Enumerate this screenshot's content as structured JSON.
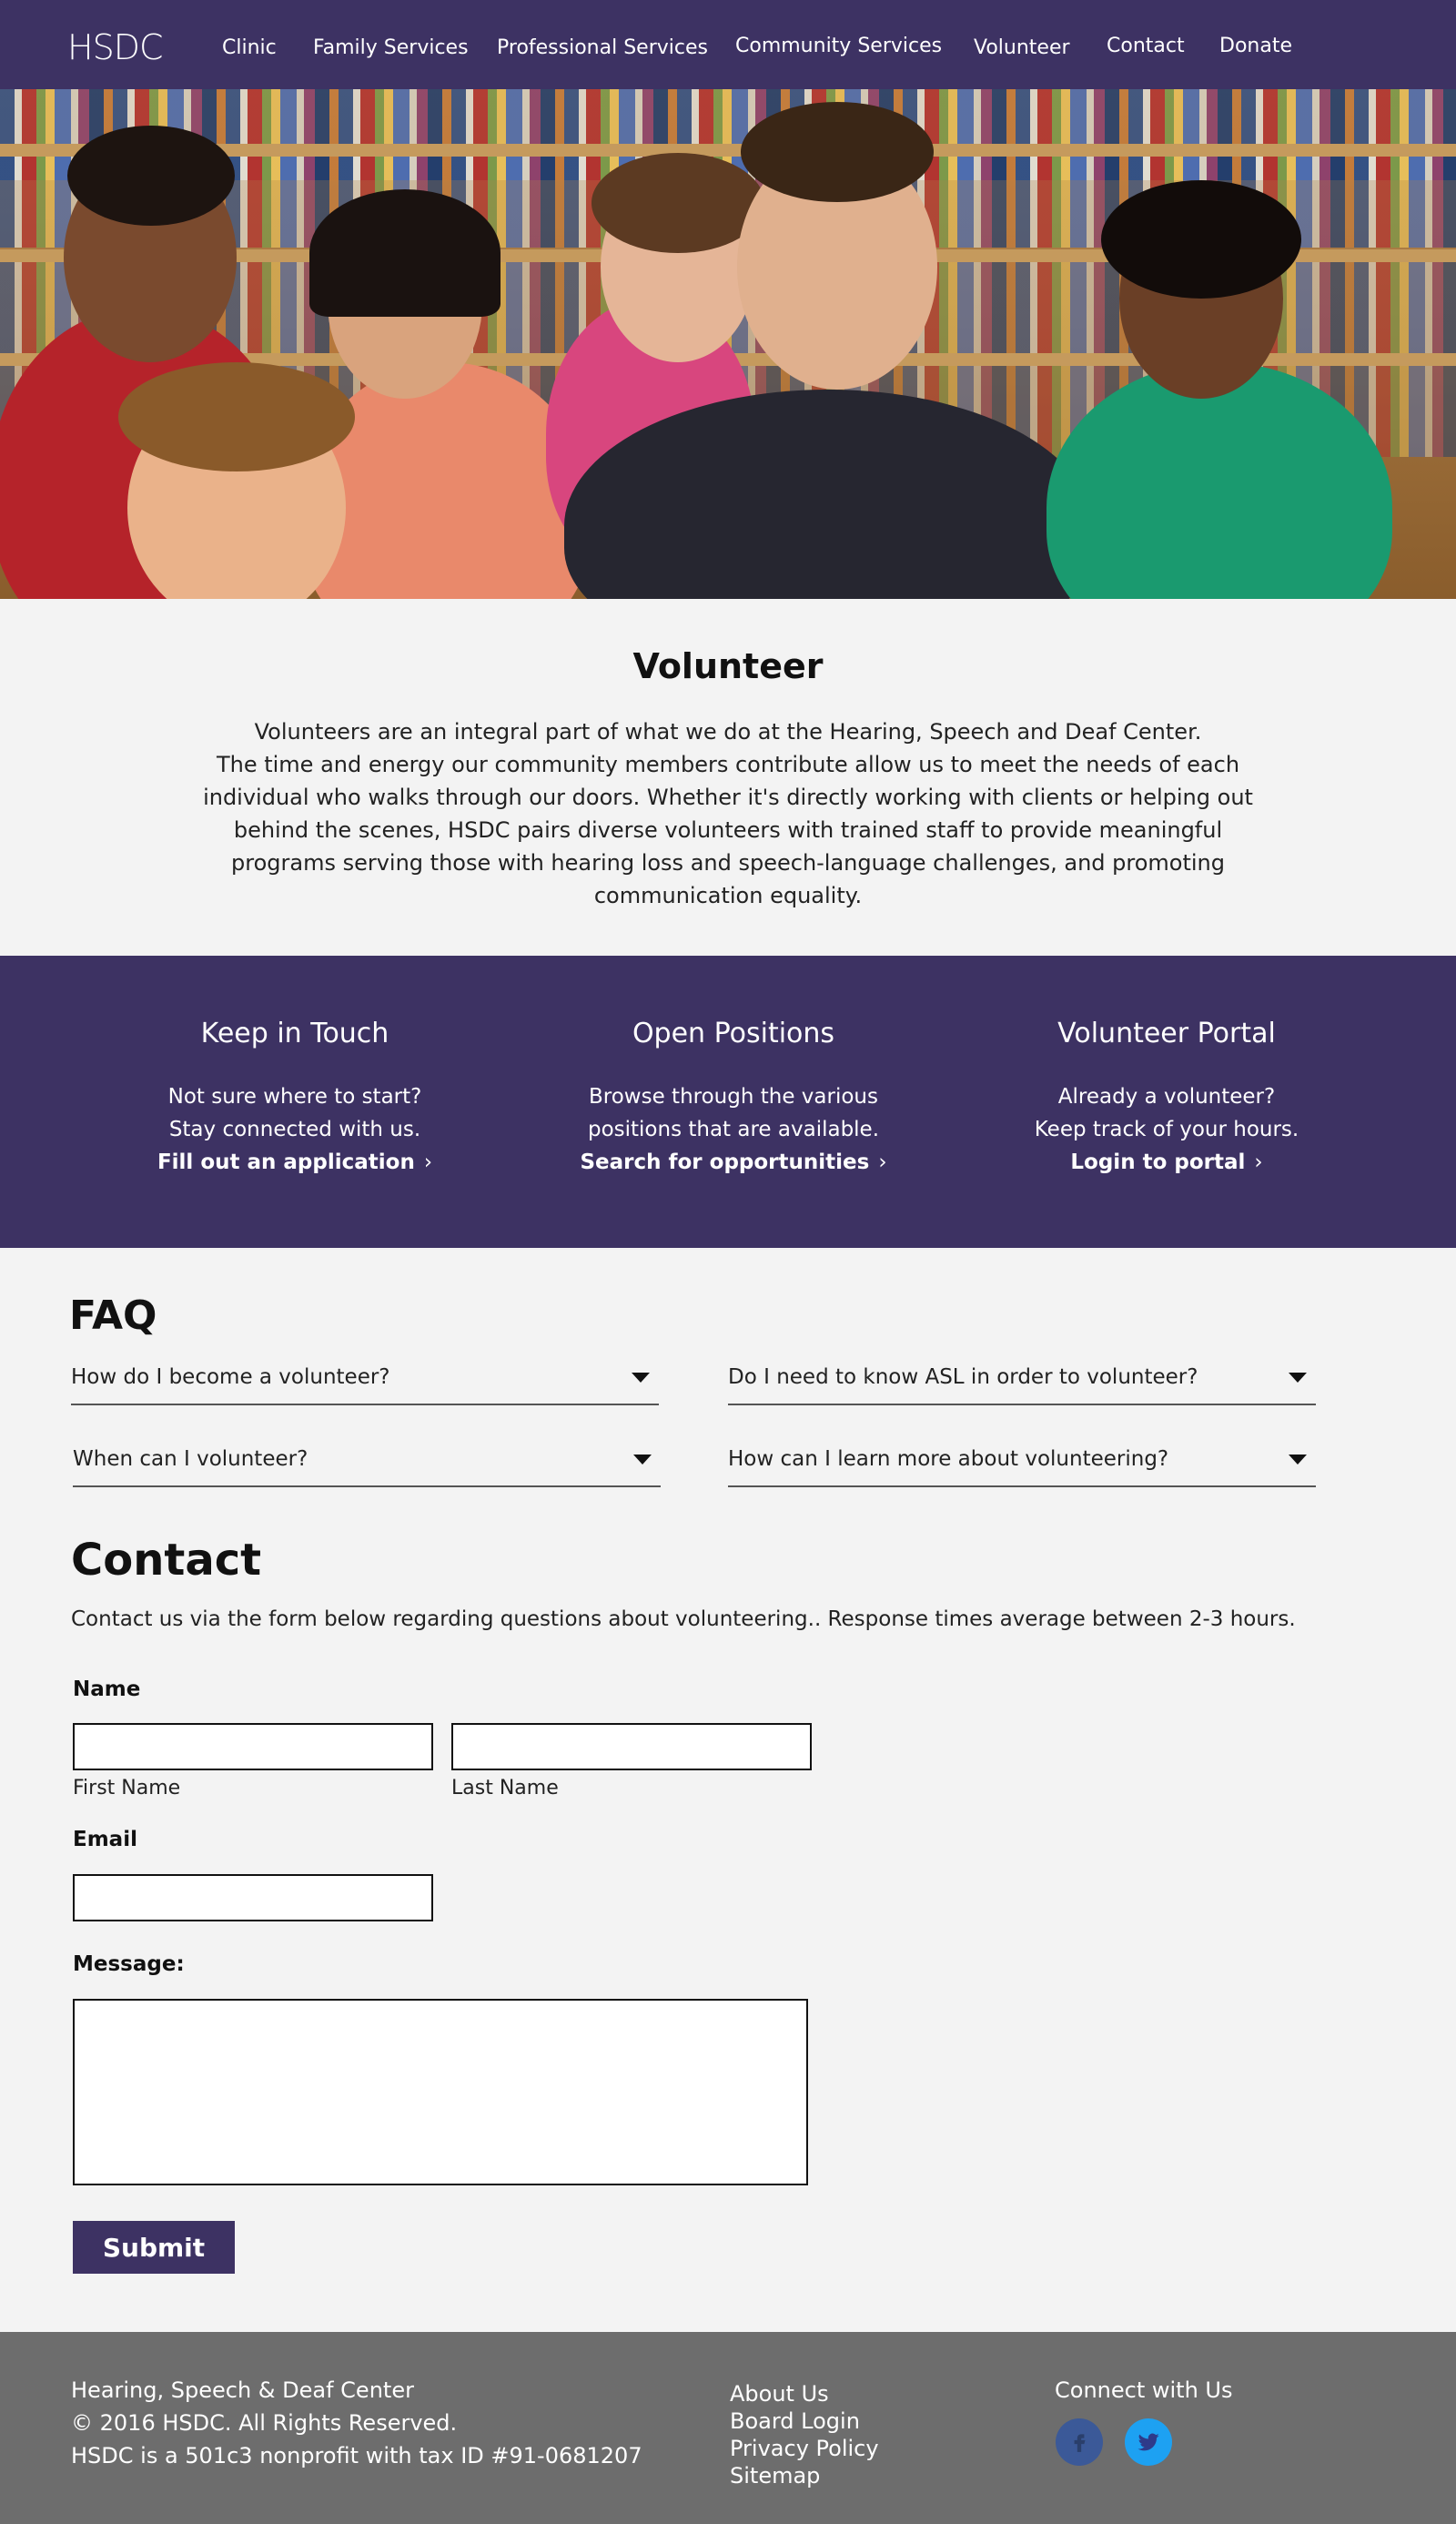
{
  "nav": {
    "logo": "HSDC",
    "items": [
      "Clinic",
      "Family Services",
      "Professional Services",
      "Community Services",
      "Volunteer",
      "Contact",
      "Donate"
    ]
  },
  "intro": {
    "title": "Volunteer",
    "lines": [
      "Volunteers are an integral part of what we do at the Hearing, Speech and Deaf Center.",
      "The time and energy our community members contribute allow us to meet the needs of each",
      "individual who walks through our doors. Whether it's directly working with clients or helping out",
      "behind the scenes, HSDC pairs diverse volunteers with trained staff to provide meaningful",
      "programs serving those with hearing loss and speech-language challenges, and promoting",
      "communication equality."
    ]
  },
  "band": {
    "columns": [
      {
        "title": "Keep in Touch",
        "line1": "Not sure where to start?",
        "line2": "Stay connected with us.",
        "link": "Fill out an application"
      },
      {
        "title": "Open Positions",
        "line1": "Browse through the various",
        "line2": "positions that are available.",
        "link": "Search for opportunities"
      },
      {
        "title": "Volunteer Portal",
        "line1": "Already a volunteer?",
        "line2": "Keep track of your hours.",
        "link": "Login to portal"
      }
    ]
  },
  "faq": {
    "title": "FAQ",
    "questions": [
      "How do I become a volunteer?",
      "Do I need to know ASL in order to volunteer?",
      "When can I volunteer?",
      "How can I learn more about volunteering?"
    ]
  },
  "contact": {
    "title": "Contact",
    "description": "Contact us via the form below regarding questions about volunteering.. Response times average between 2-3 hours.",
    "name_label": "Name",
    "first_name_label": "First Name",
    "last_name_label": "Last Name",
    "email_label": "Email",
    "message_label": "Message:",
    "first_name_value": "",
    "last_name_value": "",
    "email_value": "",
    "message_value": "",
    "submit_label": "Submit"
  },
  "footer": {
    "org_lines": [
      "Hearing, Speech & Deaf Center",
      "© 2016 HSDC. All Rights Reserved.",
      "HSDC is a 501c3 nonprofit with tax ID #91-0681207"
    ],
    "links": [
      "About Us",
      "Board Login",
      "Privacy Policy",
      "Sitemap"
    ],
    "connect_label": "Connect with Us",
    "social": [
      {
        "icon": "facebook-icon",
        "color": "#3b5998"
      },
      {
        "icon": "twitter-icon",
        "color": "#1da1f2"
      }
    ]
  },
  "colors": {
    "brand_purple": "#3d3263",
    "footer_gray": "#6d6d6d",
    "page_bg": "#f3f3f3"
  }
}
